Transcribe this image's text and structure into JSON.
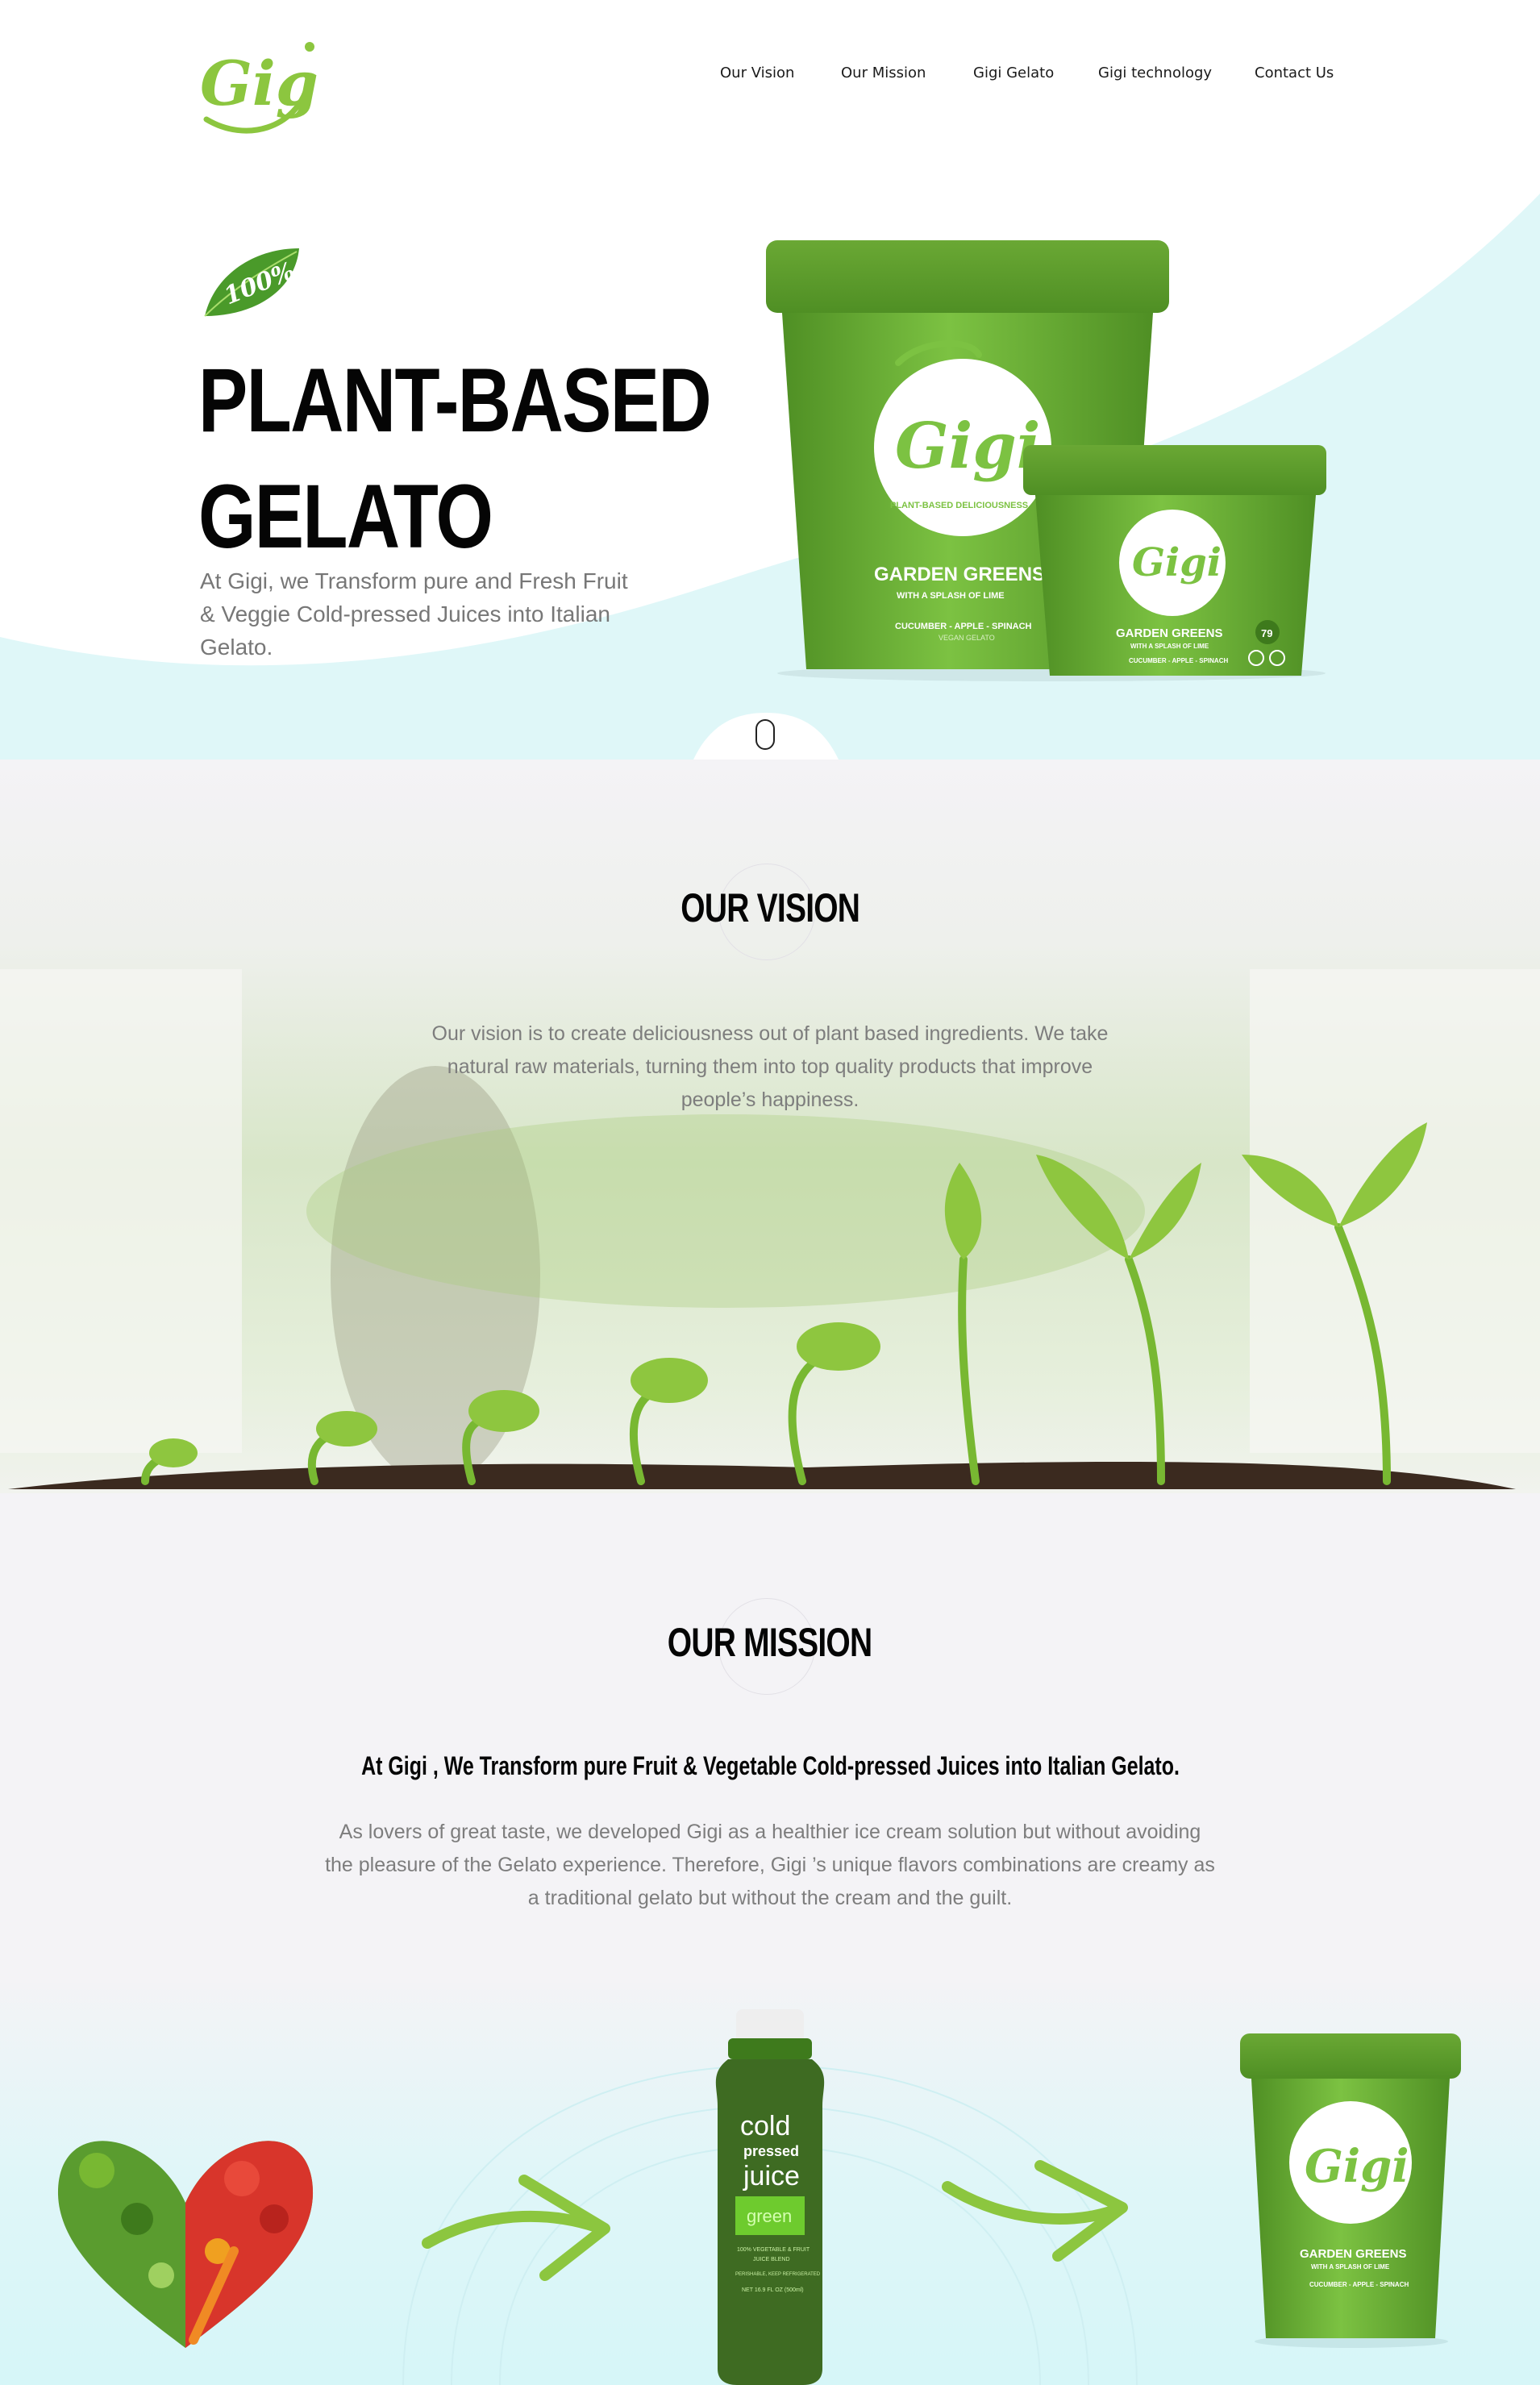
{
  "brand": {
    "logo_text": "Gigi",
    "accent": "#7cc242",
    "dark_green": "#4f8f24",
    "aqua": "#dff7f8"
  },
  "nav": {
    "items": [
      {
        "label": "Our Vision"
      },
      {
        "label": "Our Mission"
      },
      {
        "label": "Gigi Gelato"
      },
      {
        "label": "Gigi technology"
      },
      {
        "label": "Contact Us"
      }
    ]
  },
  "hero": {
    "badge_text": "100%",
    "title_line1": "PLANT-BASED",
    "title_line2": "GELATO",
    "subtitle": "At Gigi, we Transform pure and Fresh Fruit & Veggie Cold-pressed Juices into Italian Gelato.",
    "product": {
      "brand": "Gigi",
      "ring_text": "PLANT-BASED DELICIOUSNESS",
      "flavor": "GARDEN GREENS",
      "tagline": "WITH A SPLASH OF LIME",
      "ingredients": "CUCUMBER - APPLE - SPINACH",
      "type": "VEGAN GELATO",
      "calories": "79"
    },
    "scroll_icon": "mouse-scroll-icon"
  },
  "vision": {
    "title": "OUR VISION",
    "text": "Our vision is to create deliciousness out of plant based ingredients. We take natural raw materials, turning them into top quality products that improve people’s happiness."
  },
  "mission": {
    "title": "OUR MISSION",
    "heading": "At Gigi , We Transform pure Fruit & Vegetable Cold-pressed Juices into Italian Gelato.",
    "text": "As lovers of great taste, we developed Gigi as a healthier ice cream solution but without avoiding the pleasure of the Gelato experience. Therefore, Gigi ’s unique flavors combinations are creamy as a traditional gelato but without the cream and the guilt.",
    "bottle": {
      "line1": "cold",
      "line2": "pressed",
      "line3": "juice",
      "label": "green",
      "sub1": "100% VEGETABLE & FRUIT",
      "sub2": "JUICE BLEND",
      "sub3": "PERISHABLE, KEEP REFRIGERATED",
      "size": "NET 16.9 FL OZ (500ml)"
    },
    "cup": {
      "brand": "Gigi",
      "flavor": "GARDEN GREENS",
      "tagline": "WITH A SPLASH OF LIME",
      "ingredients": "CUCUMBER - APPLE - SPINACH"
    }
  }
}
